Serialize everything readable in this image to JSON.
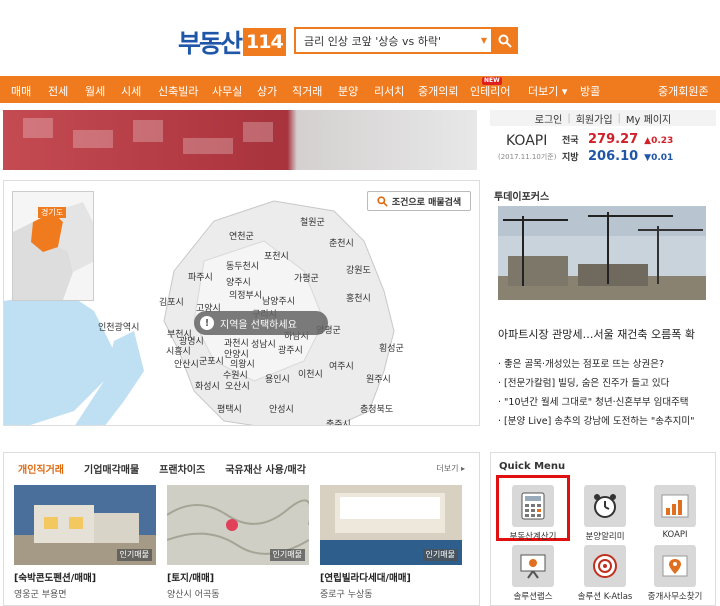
{
  "header": {
    "logo_text": "부동산",
    "logo_num": "114",
    "search_value": "금리 인상 코앞 '상승 vs 하락'"
  },
  "nav": {
    "items": [
      "매매",
      "전세",
      "월세",
      "시세",
      "신축빌라",
      "사무실",
      "상가",
      "직거래",
      "분양",
      "리서치",
      "중개의뢰",
      "인테리어",
      "더보기 ▾",
      "방콜",
      "중개회원존"
    ],
    "new_badge": "NEW"
  },
  "account": {
    "login": "로그인",
    "signup": "회원가입",
    "mypage": "My 페이지"
  },
  "koapi": {
    "title": "KOAPI",
    "date": "(2017.11.10기준)",
    "rows": [
      {
        "label": "전국",
        "value": "279.27",
        "change": "▲0.23",
        "color": "#d0202a"
      },
      {
        "label": "지방",
        "value": "206.10",
        "change": "▼0.01",
        "color": "#1f56a8"
      }
    ]
  },
  "map": {
    "condition_button": "조건으로 매물검색",
    "region_label": "경기도",
    "center_prompt": "지역을 선택하세요",
    "labels": [
      "철원군",
      "연천군",
      "춘천시",
      "포천시",
      "동두천시",
      "파주시",
      "양주시",
      "가평군",
      "강원도",
      "의정부시",
      "남양주시",
      "홍천시",
      "김포시",
      "고양시",
      "구리시",
      "인천광역시",
      "부천시",
      "양평군",
      "광명시",
      "과천시",
      "성남시",
      "광주시",
      "시흥시",
      "안양시",
      "하남시",
      "안산시",
      "군포시",
      "의왕시",
      "횡성군",
      "수원시",
      "여주시",
      "화성시",
      "오산시",
      "용인시",
      "이천시",
      "원주시",
      "평택시",
      "안성시",
      "충청북도",
      "충주시"
    ]
  },
  "focus": {
    "title": "투데이포커스",
    "headline": "아파트시장 관망세…서울 재건축 오름폭 확",
    "news": [
      "· 좋은 골목·개성있는 점포로 뜨는 상권은?",
      "· [전문가칼럼] 빌딩, 숨은 진주가 들고 있다",
      "· \"10년간 월세 그대로\" 청년·신혼부부 임대주택",
      "· [분양 Live] 송추의 강남에 도전하는 \"송추지미\""
    ]
  },
  "listings": {
    "tabs": [
      "개인직거래",
      "기업매각매물",
      "프랜차이즈",
      "국유재산 사용/매각"
    ],
    "more": "더보기 ▸",
    "cards": [
      {
        "title": "[숙박콘도펜션/매매]",
        "location": "영웅군 부용면",
        "badge": "인기매물"
      },
      {
        "title": "[토지/매매]",
        "location": "양산시 어곡동",
        "badge": "인기매물"
      },
      {
        "title": "[연립빌라다세대/매매]",
        "location": "중로구 누상동",
        "badge": "인기매물"
      }
    ]
  },
  "quick": {
    "title": "Quick Menu",
    "items": [
      "부동산계산기",
      "분양알리미",
      "KOAPI",
      "솔루션랩스",
      "솔루션 K-Atlas",
      "중개사무소찾기"
    ]
  }
}
